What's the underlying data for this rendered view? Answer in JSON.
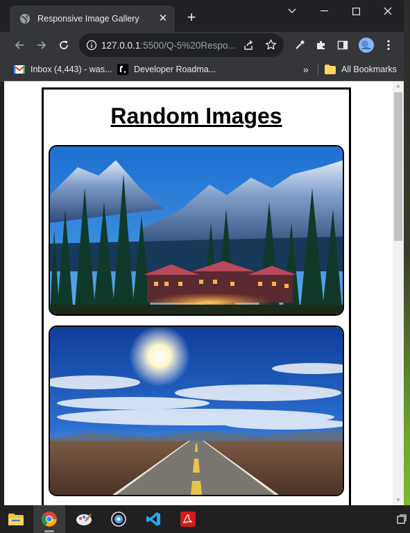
{
  "browser": {
    "tab_title": "Responsive Image Gallery",
    "address": {
      "host": "127.0.0.1",
      "path": ":5500/Q-5%20Respo..."
    },
    "bookmarks": [
      {
        "label": "Inbox (4,443) - was...",
        "icon": "gmail-icon"
      },
      {
        "label": "Developer Roadma...",
        "icon": "roadmap-icon"
      }
    ],
    "all_bookmarks_label": "All Bookmarks",
    "overflow_label": "»"
  },
  "page": {
    "heading": "Random Images",
    "images": [
      {
        "name": "mountain-lodge-image",
        "alt": "Mountain lodge among pine trees at dusk"
      },
      {
        "name": "desert-road-image",
        "alt": "Straight road under bright sun and blue sky"
      }
    ]
  },
  "taskbar": {
    "apps": [
      "file-explorer-icon",
      "chrome-icon",
      "paint-icon",
      "media-icon",
      "vscode-icon",
      "acrobat-icon"
    ]
  },
  "colors": {
    "chrome_dark": "#202124",
    "chrome_toolbar": "#35363a",
    "page_bg": "#ffffff",
    "accent_blue": "#1a73e8"
  }
}
